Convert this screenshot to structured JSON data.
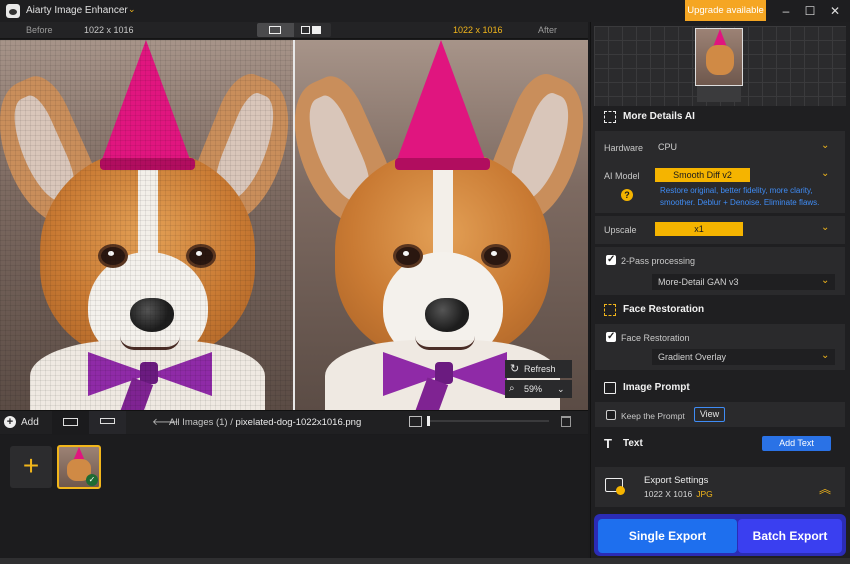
{
  "app": {
    "title": "Aiarty Image Enhancer",
    "upgrade_label": "Upgrade available"
  },
  "compare": {
    "before_label": "Before",
    "before_dims": "1022 x 1016",
    "after_dims": "1022 x 1016",
    "after_label": "After"
  },
  "preview": {
    "refresh_label": "Refresh",
    "zoom_level": "59%"
  },
  "bottom": {
    "add_label": "Add",
    "breadcrumb_root": "All Images (1)",
    "breadcrumb_sep": "/",
    "breadcrumb_file": "pixelated-dog-1022x1016.png"
  },
  "panel": {
    "more_details": {
      "title": "More Details AI",
      "hardware_label": "Hardware",
      "hardware_value": "CPU",
      "ai_model_label": "AI Model",
      "ai_model_value": "Smooth Diff  v2",
      "ai_model_desc": "Restore original, better fidelity, more clarity, smoother. Deblur + Denoise. Eliminate flaws.",
      "upscale_label": "Upscale",
      "upscale_value": "x1",
      "two_pass_label": "2-Pass processing",
      "two_pass_checked": true,
      "two_pass_model": "More-Detail GAN  v3"
    },
    "face": {
      "title": "Face Restoration",
      "checkbox_label": "Face Restoration",
      "checked": true,
      "mode": "Gradient Overlay"
    },
    "prompt": {
      "title": "Image Prompt",
      "keep_label": "Keep the Prompt",
      "view_label": "View"
    },
    "text": {
      "title": "Text",
      "add_label": "Add Text"
    },
    "export": {
      "title": "Export Settings",
      "dims": "1022 X 1016",
      "format": "JPG",
      "single_label": "Single Export",
      "batch_label": "Batch Export"
    }
  },
  "colors": {
    "accent": "#f5b400",
    "link": "#3f8cf5",
    "primary_button": "#1e6fee",
    "batch_button": "#3a3ff0",
    "upgrade": "#f5a623"
  }
}
